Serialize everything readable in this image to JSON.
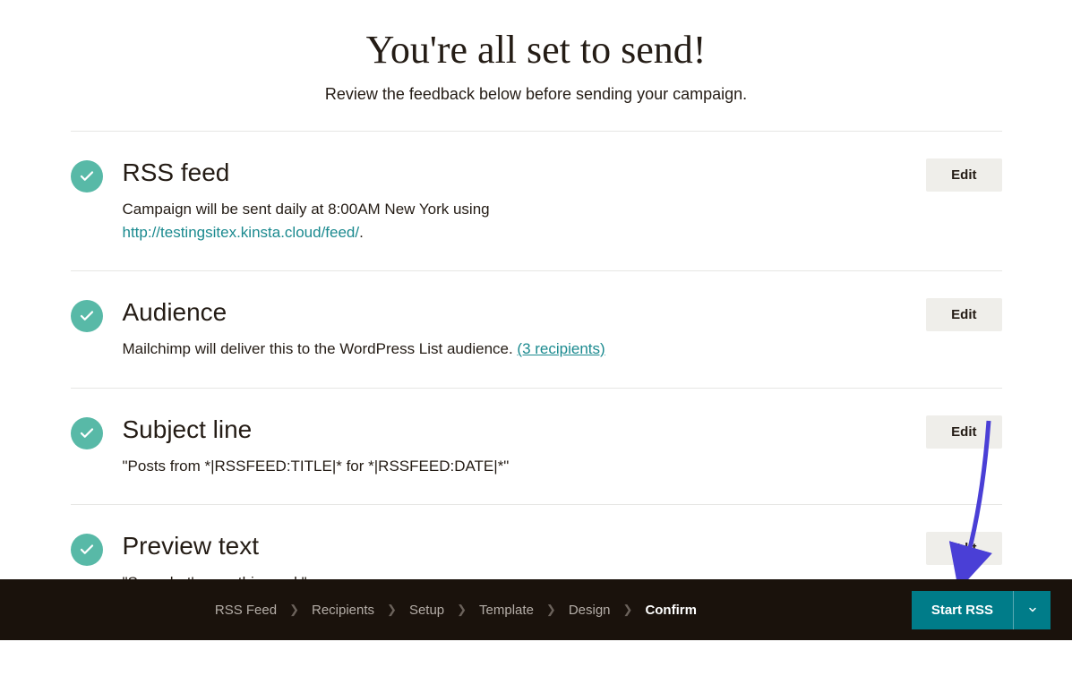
{
  "hero": {
    "title": "You're all set to send!",
    "subtitle": "Review the feedback below before sending your campaign."
  },
  "sections": {
    "rss": {
      "title": "RSS feed",
      "desc_prefix": "Campaign will be sent daily at 8:00AM New York using ",
      "link_text": "http://testingsitex.kinsta.cloud/feed/",
      "desc_suffix": ".",
      "edit": "Edit"
    },
    "audience": {
      "title": "Audience",
      "desc_prefix": "Mailchimp will deliver this to the WordPress List audience. ",
      "link_text": "(3 recipients)",
      "edit": "Edit"
    },
    "subject": {
      "title": "Subject line",
      "desc": "\"Posts from *|RSSFEED:TITLE|* for *|RSSFEED:DATE|*\"",
      "edit": "Edit"
    },
    "preview": {
      "title": "Preview text",
      "desc": "\"See what's new this week\"",
      "edit": "Edit"
    }
  },
  "footer": {
    "steps": [
      "RSS Feed",
      "Recipients",
      "Setup",
      "Template",
      "Design",
      "Confirm"
    ],
    "active_step": "Confirm",
    "start_label": "Start RSS"
  }
}
